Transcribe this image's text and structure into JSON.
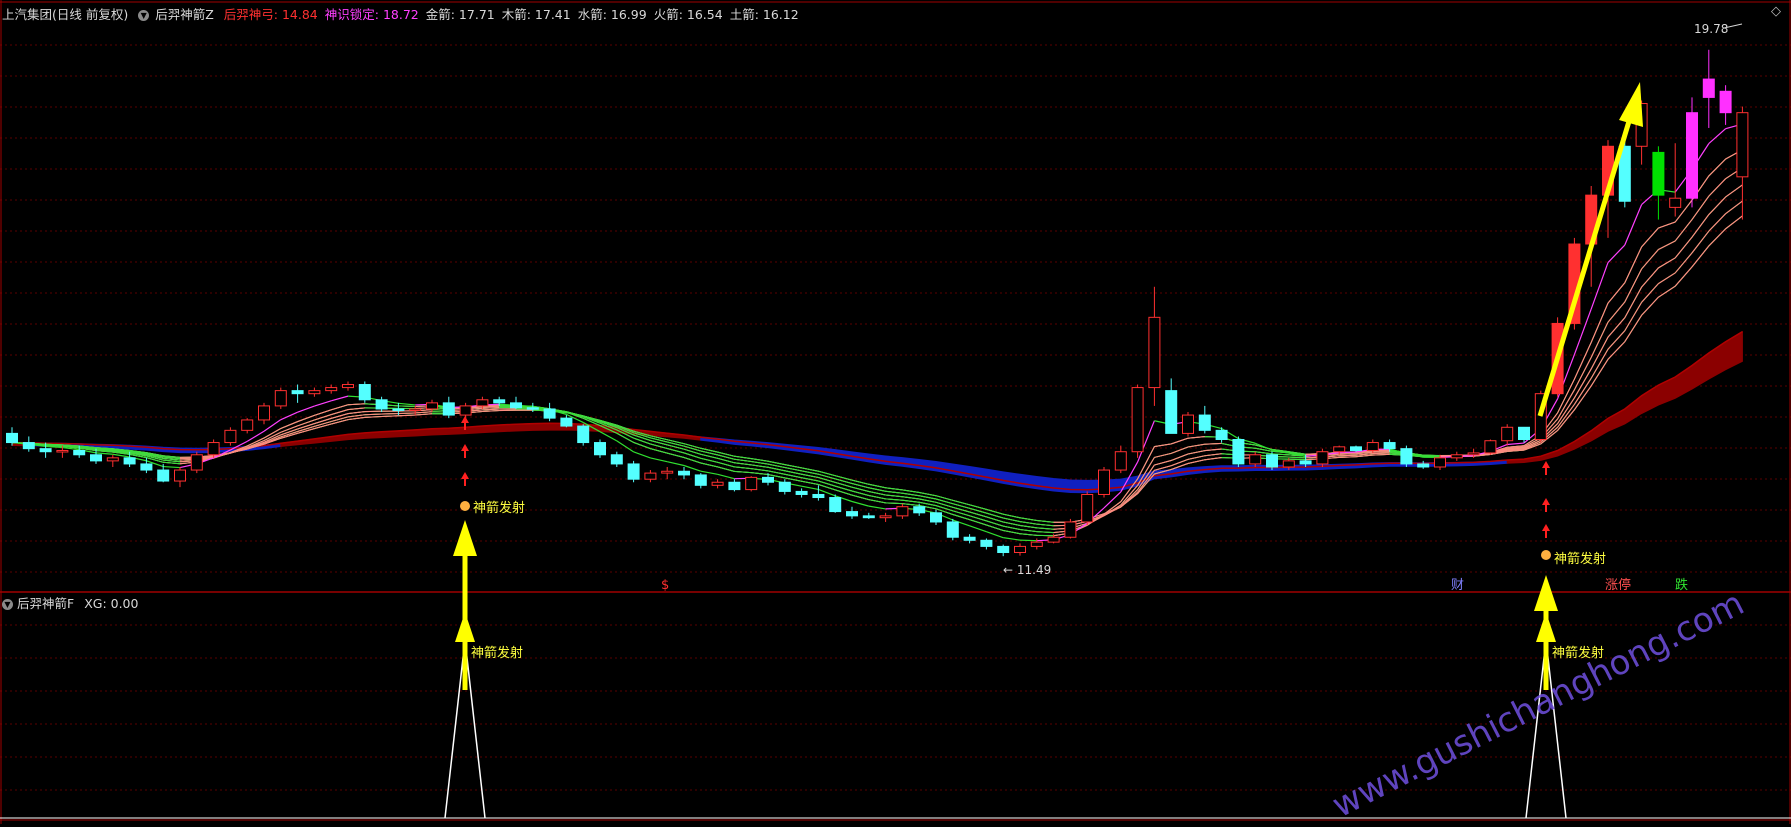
{
  "header": {
    "stock_name": "上汽集团(日线 前复权)",
    "indicator_name": "后羿神箭Z",
    "fields": [
      {
        "label": "后羿神弓",
        "value": "14.84",
        "color": "#ff3030"
      },
      {
        "label": "神识锁定",
        "value": "18.72",
        "color": "#ff40ff"
      },
      {
        "label": "金箭",
        "value": "17.71",
        "color": "#d8d8d8"
      },
      {
        "label": "木箭",
        "value": "17.41",
        "color": "#d8d8d8"
      },
      {
        "label": "水箭",
        "value": "16.99",
        "color": "#d8d8d8"
      },
      {
        "label": "火箭",
        "value": "16.54",
        "color": "#d8d8d8"
      },
      {
        "label": "土箭",
        "value": "16.12",
        "color": "#d8d8d8"
      }
    ]
  },
  "sub_header": {
    "indicator_name": "后羿神箭F",
    "field_label": "XG",
    "field_value": "0.00"
  },
  "labels": {
    "max_price": "19.78",
    "min_price": "11.49",
    "signal_text": "神箭发射",
    "dollar": "$",
    "cai": "财",
    "zhangting": "涨停",
    "die": "跌",
    "watermark": "www.gushichanghong.com",
    "corner": "◇"
  },
  "colors": {
    "up": "#ff3030",
    "down": "#54ffff",
    "background": "#000000",
    "grid": "#5a0000",
    "divider": "#a00000",
    "arrow": "#ffff00",
    "blue_band": "#1020c0",
    "red_band": "#8b0000",
    "watermark": "#7050e0"
  },
  "chart_data": {
    "type": "candlestick",
    "series": [
      {
        "name": "后羿神弓"
      },
      {
        "name": "神识锁定"
      },
      {
        "name": "金箭"
      },
      {
        "name": "木箭"
      },
      {
        "name": "水箭"
      },
      {
        "name": "火箭"
      },
      {
        "name": "土箭"
      },
      {
        "name": "XG"
      }
    ],
    "last_values": {
      "后羿神弓": 14.84,
      "神识锁定": 18.72,
      "金箭": 17.71,
      "木箭": 17.41,
      "水箭": 16.99,
      "火箭": 16.54,
      "土箭": 16.12,
      "XG": 0.0
    },
    "highest": 19.78,
    "lowest": 11.49,
    "candles": [
      [
        13.5,
        13.6,
        13.3,
        13.35
      ],
      [
        13.35,
        13.45,
        13.2,
        13.25
      ],
      [
        13.25,
        13.35,
        13.1,
        13.2
      ],
      [
        13.2,
        13.3,
        13.1,
        13.22
      ],
      [
        13.22,
        13.3,
        13.1,
        13.15
      ],
      [
        13.15,
        13.25,
        13.0,
        13.05
      ],
      [
        13.05,
        13.15,
        12.95,
        13.1
      ],
      [
        13.1,
        13.2,
        12.95,
        13.0
      ],
      [
        13.0,
        13.1,
        12.85,
        12.9
      ],
      [
        12.9,
        13.0,
        12.7,
        12.72
      ],
      [
        12.72,
        12.95,
        12.62,
        12.9
      ],
      [
        12.9,
        13.2,
        12.85,
        13.15
      ],
      [
        13.15,
        13.4,
        13.1,
        13.35
      ],
      [
        13.35,
        13.6,
        13.3,
        13.55
      ],
      [
        13.55,
        13.75,
        13.5,
        13.72
      ],
      [
        13.72,
        14.0,
        13.65,
        13.95
      ],
      [
        13.95,
        14.25,
        13.9,
        14.2
      ],
      [
        14.2,
        14.3,
        14.0,
        14.15
      ],
      [
        14.15,
        14.25,
        14.1,
        14.2
      ],
      [
        14.2,
        14.3,
        14.15,
        14.25
      ],
      [
        14.25,
        14.35,
        14.2,
        14.3
      ],
      [
        14.3,
        14.35,
        14.0,
        14.05
      ],
      [
        14.05,
        14.1,
        13.85,
        13.9
      ],
      [
        13.9,
        14.0,
        13.8,
        13.88
      ],
      [
        13.88,
        13.95,
        13.8,
        13.9
      ],
      [
        13.9,
        14.05,
        13.85,
        14.0
      ],
      [
        14.0,
        14.1,
        13.75,
        13.8
      ],
      [
        13.8,
        14.0,
        13.75,
        13.95
      ],
      [
        13.95,
        14.1,
        13.9,
        14.05
      ],
      [
        14.05,
        14.1,
        13.95,
        14.0
      ],
      [
        14.0,
        14.1,
        13.9,
        13.92
      ],
      [
        13.92,
        14.0,
        13.85,
        13.9
      ],
      [
        13.9,
        14.0,
        13.7,
        13.75
      ],
      [
        13.75,
        13.8,
        13.6,
        13.62
      ],
      [
        13.62,
        13.65,
        13.3,
        13.35
      ],
      [
        13.35,
        13.4,
        13.1,
        13.15
      ],
      [
        13.15,
        13.2,
        12.95,
        13.0
      ],
      [
        13.0,
        13.05,
        12.7,
        12.75
      ],
      [
        12.75,
        12.9,
        12.7,
        12.85
      ],
      [
        12.85,
        12.95,
        12.75,
        12.88
      ],
      [
        12.88,
        12.95,
        12.75,
        12.82
      ],
      [
        12.82,
        12.85,
        12.6,
        12.65
      ],
      [
        12.65,
        12.75,
        12.6,
        12.7
      ],
      [
        12.7,
        12.75,
        12.55,
        12.58
      ],
      [
        12.58,
        12.8,
        12.55,
        12.78
      ],
      [
        12.78,
        12.85,
        12.65,
        12.7
      ],
      [
        12.7,
        12.75,
        12.5,
        12.55
      ],
      [
        12.55,
        12.6,
        12.45,
        12.5
      ],
      [
        12.5,
        12.65,
        12.4,
        12.45
      ],
      [
        12.45,
        12.5,
        12.2,
        12.22
      ],
      [
        12.22,
        12.3,
        12.1,
        12.15
      ],
      [
        12.15,
        12.2,
        12.1,
        12.12
      ],
      [
        12.12,
        12.2,
        12.05,
        12.15
      ],
      [
        12.15,
        12.35,
        12.1,
        12.3
      ],
      [
        12.3,
        12.35,
        12.15,
        12.2
      ],
      [
        12.2,
        12.25,
        12.0,
        12.05
      ],
      [
        12.05,
        12.1,
        11.75,
        11.8
      ],
      [
        11.8,
        11.85,
        11.7,
        11.75
      ],
      [
        11.75,
        11.78,
        11.6,
        11.65
      ],
      [
        11.65,
        11.68,
        11.49,
        11.55
      ],
      [
        11.55,
        11.7,
        11.5,
        11.65
      ],
      [
        11.65,
        11.78,
        11.6,
        11.72
      ],
      [
        11.72,
        11.85,
        11.7,
        11.8
      ],
      [
        11.8,
        12.1,
        11.78,
        12.05
      ],
      [
        12.05,
        12.55,
        12.0,
        12.5
      ],
      [
        12.5,
        12.95,
        12.45,
        12.9
      ],
      [
        12.9,
        13.3,
        12.85,
        13.2
      ],
      [
        13.2,
        14.3,
        13.1,
        14.25
      ],
      [
        14.25,
        15.9,
        13.95,
        15.4
      ],
      [
        14.2,
        14.4,
        13.5,
        13.5
      ],
      [
        13.5,
        13.85,
        13.45,
        13.8
      ],
      [
        13.8,
        13.95,
        13.5,
        13.55
      ],
      [
        13.55,
        13.6,
        13.35,
        13.4
      ],
      [
        13.4,
        13.45,
        12.95,
        13.0
      ],
      [
        13.0,
        13.2,
        12.95,
        13.15
      ],
      [
        13.15,
        13.2,
        12.9,
        12.95
      ],
      [
        12.95,
        13.1,
        12.9,
        13.05
      ],
      [
        13.05,
        13.15,
        12.95,
        13.0
      ],
      [
        13.0,
        13.25,
        12.95,
        13.2
      ],
      [
        13.2,
        13.3,
        13.15,
        13.28
      ],
      [
        13.28,
        13.3,
        13.2,
        13.22
      ],
      [
        13.22,
        13.4,
        13.18,
        13.35
      ],
      [
        13.35,
        13.4,
        13.2,
        13.25
      ],
      [
        13.25,
        13.3,
        12.95,
        13.0
      ],
      [
        13.0,
        13.05,
        12.92,
        12.95
      ],
      [
        12.95,
        13.15,
        12.9,
        13.1
      ],
      [
        13.1,
        13.2,
        13.05,
        13.15
      ],
      [
        13.15,
        13.25,
        13.1,
        13.18
      ],
      [
        13.18,
        13.4,
        13.15,
        13.38
      ],
      [
        13.38,
        13.65,
        13.3,
        13.6
      ],
      [
        13.6,
        13.6,
        13.35,
        13.4
      ],
      [
        13.4,
        14.2,
        13.35,
        14.15
      ],
      [
        14.15,
        15.4,
        14.1,
        15.3
      ],
      [
        15.3,
        16.7,
        15.2,
        16.6
      ],
      [
        16.6,
        17.55,
        15.9,
        17.4
      ],
      [
        17.4,
        18.3,
        16.7,
        18.2
      ],
      [
        18.2,
        18.35,
        17.2,
        17.3
      ],
      [
        18.2,
        18.95,
        17.9,
        18.9
      ],
      [
        17.4,
        18.2,
        17.0,
        18.1
      ],
      [
        17.2,
        18.25,
        17.05,
        17.35
      ],
      [
        17.35,
        19.0,
        17.2,
        18.75
      ],
      [
        19.0,
        19.78,
        18.5,
        19.3
      ],
      [
        18.75,
        19.2,
        18.55,
        19.1
      ],
      [
        17.7,
        18.85,
        17.0,
        18.75
      ]
    ]
  }
}
